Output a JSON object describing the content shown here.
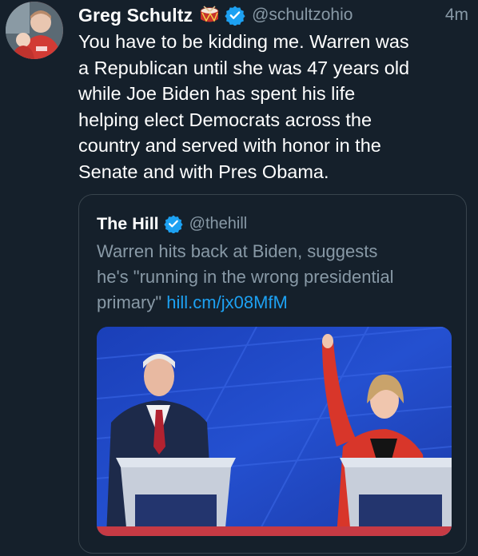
{
  "tweet": {
    "author_name": "Greg Schultz",
    "author_handle": "@schultzohio",
    "timestamp": "4m",
    "text_lines": [
      "You have to be kidding me. Warren was",
      "a Republican until she was 47 years old",
      "while Joe Biden has spent his life",
      "helping elect Democrats across the",
      "country and served with honor in the",
      "Senate and with Pres Obama."
    ]
  },
  "quote": {
    "author_name": "The Hill",
    "author_handle": "@thehill",
    "text_lines": [
      "Warren hits back at Biden, suggests",
      "he's \"running in the wrong presidential",
      "primary\""
    ],
    "link": "hill.cm/jx08MfM"
  },
  "colors": {
    "background": "#15202b",
    "secondary_text": "#8899a6",
    "link": "#1da1f2",
    "border": "#38444d",
    "verified": "#1da1f2"
  },
  "icons": {
    "emoji": "drum-emoji-icon",
    "verified": "verified-badge-icon"
  }
}
